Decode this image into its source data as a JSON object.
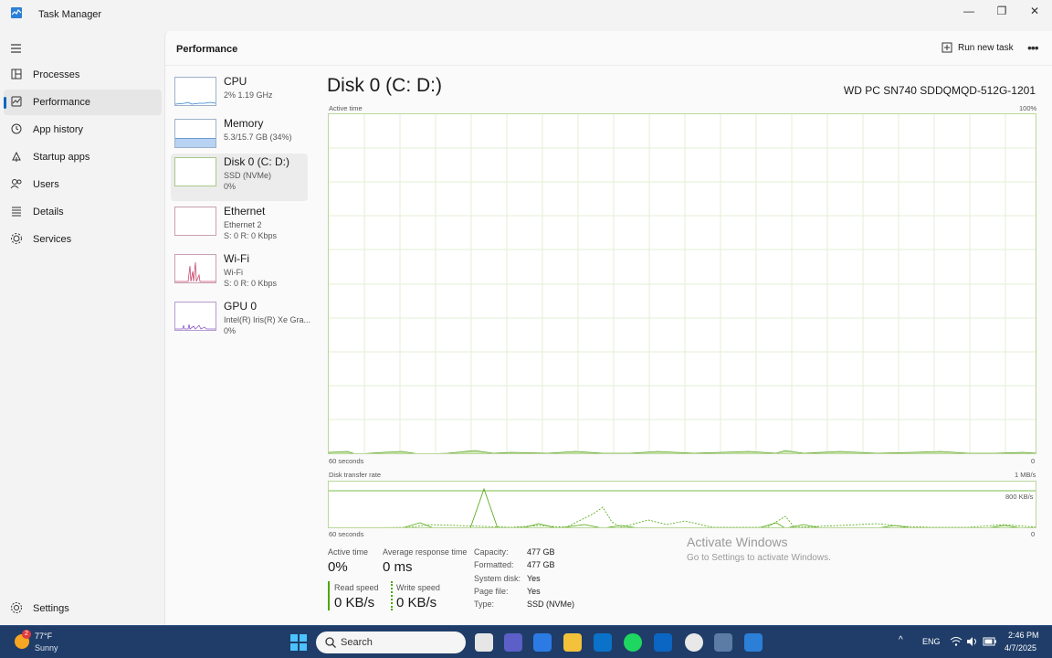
{
  "window": {
    "title": "Task Manager",
    "minimize_glyph": "—",
    "maximize_glyph": "❐",
    "close_glyph": "✕"
  },
  "sidebar": {
    "items": [
      {
        "label": "Processes",
        "icon": "processes-icon"
      },
      {
        "label": "Performance",
        "icon": "performance-icon",
        "active": true
      },
      {
        "label": "App history",
        "icon": "history-icon"
      },
      {
        "label": "Startup apps",
        "icon": "startup-icon"
      },
      {
        "label": "Users",
        "icon": "users-icon"
      },
      {
        "label": "Details",
        "icon": "details-icon"
      },
      {
        "label": "Services",
        "icon": "services-icon"
      }
    ],
    "settings_label": "Settings"
  },
  "header": {
    "title": "Performance",
    "run_task_label": "Run new task",
    "more_glyph": "•••"
  },
  "devices": [
    {
      "name": "CPU",
      "sub1": "2%  1.19 GHz",
      "sub2": ""
    },
    {
      "name": "Memory",
      "sub1": "5.3/15.7 GB (34%)",
      "sub2": ""
    },
    {
      "name": "Disk 0 (C: D:)",
      "sub1": "SSD (NVMe)",
      "sub2": "0%",
      "active": true
    },
    {
      "name": "Ethernet",
      "sub1": "Ethernet 2",
      "sub2": "S: 0  R: 0 Kbps"
    },
    {
      "name": "Wi-Fi",
      "sub1": "Wi-Fi",
      "sub2": "S: 0  R: 0 Kbps"
    },
    {
      "name": "GPU 0",
      "sub1": "Intel(R) Iris(R) Xe Gra...",
      "sub2": "0%"
    }
  ],
  "disk": {
    "title": "Disk 0 (C: D:)",
    "model": "WD PC SN740 SDDQMQD-512G-1201",
    "active_time_graph": {
      "label": "Active time",
      "max_label": "100%",
      "time_label": "60 seconds",
      "min_label": "0"
    },
    "transfer_graph": {
      "label": "Disk transfer rate",
      "max_label": "1 MB/s",
      "mid_label": "800 KB/s",
      "time_label": "60 seconds",
      "min_label": "0"
    },
    "stats": {
      "active_time_label": "Active time",
      "active_time_value": "0%",
      "avg_response_label": "Average response time",
      "avg_response_value": "0 ms",
      "read_speed_label": "Read speed",
      "read_speed_value": "0 KB/s",
      "write_speed_label": "Write speed",
      "write_speed_value": "0 KB/s"
    },
    "properties": [
      {
        "key": "Capacity:",
        "value": "477 GB"
      },
      {
        "key": "Formatted:",
        "value": "477 GB"
      },
      {
        "key": "System disk:",
        "value": "Yes"
      },
      {
        "key": "Page file:",
        "value": "Yes"
      },
      {
        "key": "Type:",
        "value": "SSD (NVMe)"
      }
    ]
  },
  "watermark": {
    "line1": "Activate Windows",
    "line2": "Go to Settings to activate Windows."
  },
  "taskbar": {
    "weather_badge": "2",
    "weather_temp": "77°F",
    "weather_cond": "Sunny",
    "search_label": "Search",
    "apps": [
      "file-explorer-icon",
      "teams-icon",
      "store-icon",
      "folder-icon",
      "outlook-icon",
      "spotify-icon",
      "linkedin-icon",
      "chrome-icon",
      "device-icon",
      "task-manager-icon"
    ],
    "tray_chevron": "^",
    "language": "ENG",
    "time": "2:46 PM",
    "date": "4/7/2025"
  },
  "colors": {
    "accent": "#0067c0",
    "disk_graph": "#4da60c",
    "disk_fill": "#c6e5a8",
    "taskbar": "#1f3d68"
  }
}
